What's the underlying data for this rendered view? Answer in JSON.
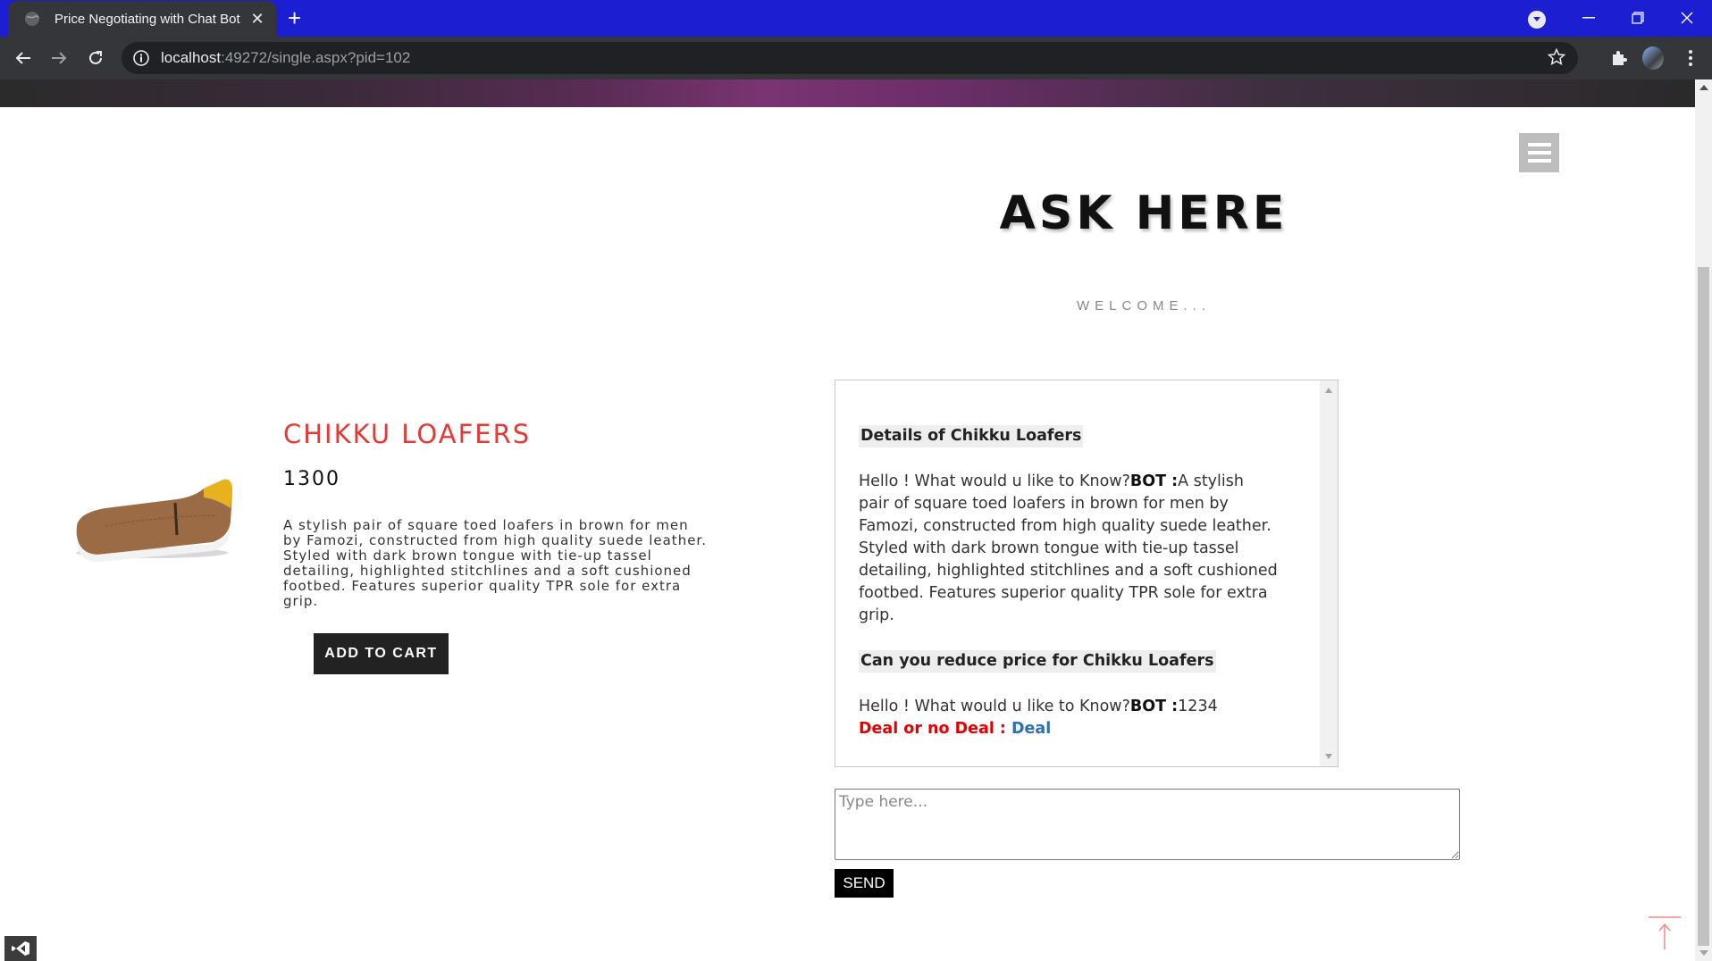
{
  "browser": {
    "tab_title": "Price Negotiating with Chat Bot",
    "tab_close": "✕",
    "new_tab": "+",
    "url_host": "localhost",
    "url_rest": ":49272/single.aspx?pid=102"
  },
  "page": {
    "heading": "ASK HERE",
    "subheading": "WELCOME..."
  },
  "product": {
    "name": "CHIKKU LOAFERS",
    "price": "1300",
    "description": "A stylish pair of square toed loafers in brown for men by Famozi, constructed from high quality suede leather. Styled with dark brown tongue with tie-up tassel detailing, highlighted stitchlines and a soft cushioned footbed. Features superior quality TPR sole for extra grip.",
    "add_to_cart": "ADD TO CART"
  },
  "chat": {
    "messages": [
      {
        "user": "Details of Chikku Loafers",
        "bot_prefix": "Hello ! What would u like to Know?",
        "bot_label": "BOT :",
        "bot_text": "A stylish pair of square toed loafers in brown for men by Famozi, constructed from high quality suede leather. Styled with dark brown tongue with tie-up tassel detailing, highlighted stitchlines and a soft cushioned footbed. Features superior quality TPR sole for extra grip."
      },
      {
        "user": "Can you reduce price for Chikku Loafers",
        "bot_prefix": "Hello ! What would u like to Know?",
        "bot_label": "BOT :",
        "bot_text": "1234"
      }
    ],
    "deal_label": "Deal or no Deal : ",
    "deal_value": "Deal",
    "input_placeholder": "Type here...",
    "send_label": "SEND"
  },
  "colors": {
    "titlebar": "#1c1ed1",
    "product_name": "#e53935",
    "deal_label": "#e40000",
    "deal_value": "#2f6fb3"
  }
}
